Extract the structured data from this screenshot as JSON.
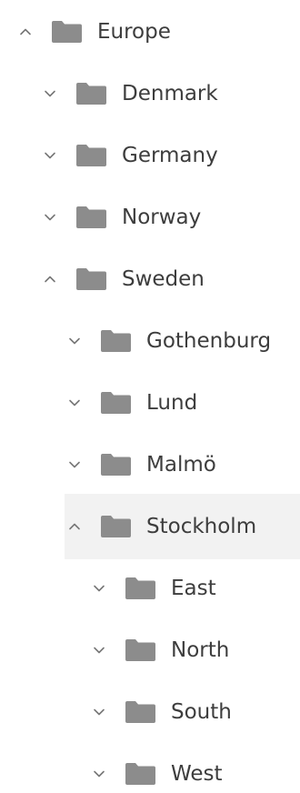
{
  "colors": {
    "text": "#3d3d3d",
    "folder": "#8c8c8c",
    "chevron": "#777777",
    "selected_background": "#f2f2f2"
  },
  "icons": {
    "expanded": "chevron-up-icon",
    "collapsed": "chevron-down-icon",
    "node": "folder-icon"
  },
  "tree": [
    {
      "label": "Europe",
      "level": 0,
      "expanded": true,
      "selected": false
    },
    {
      "label": "Denmark",
      "level": 1,
      "expanded": false,
      "selected": false
    },
    {
      "label": "Germany",
      "level": 1,
      "expanded": false,
      "selected": false
    },
    {
      "label": "Norway",
      "level": 1,
      "expanded": false,
      "selected": false
    },
    {
      "label": "Sweden",
      "level": 1,
      "expanded": true,
      "selected": false
    },
    {
      "label": "Gothenburg",
      "level": 2,
      "expanded": false,
      "selected": false
    },
    {
      "label": "Lund",
      "level": 2,
      "expanded": false,
      "selected": false
    },
    {
      "label": "Malmö",
      "level": 2,
      "expanded": false,
      "selected": false
    },
    {
      "label": "Stockholm",
      "level": 2,
      "expanded": true,
      "selected": true
    },
    {
      "label": "East",
      "level": 3,
      "expanded": false,
      "selected": false
    },
    {
      "label": "North",
      "level": 3,
      "expanded": false,
      "selected": false
    },
    {
      "label": "South",
      "level": 3,
      "expanded": false,
      "selected": false
    },
    {
      "label": "West",
      "level": 3,
      "expanded": false,
      "selected": false
    }
  ]
}
